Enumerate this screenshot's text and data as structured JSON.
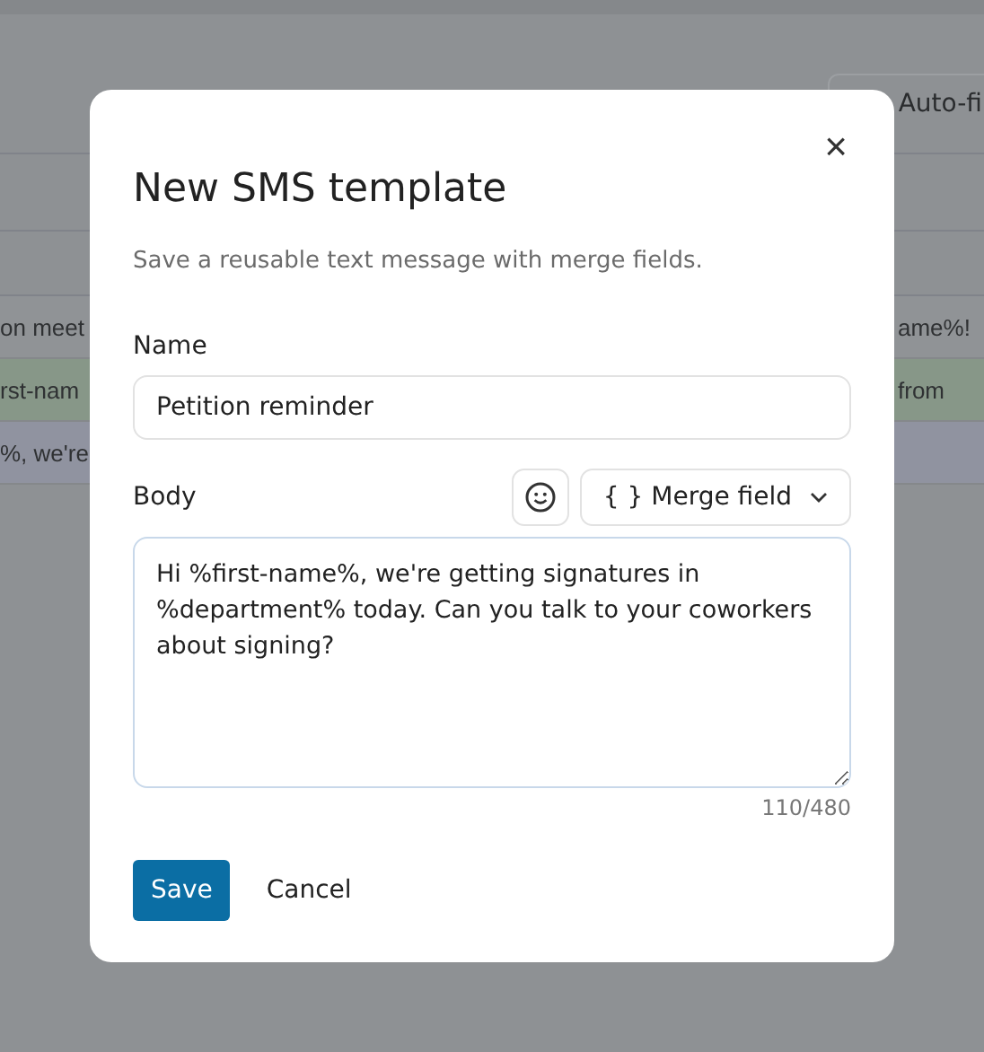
{
  "background": {
    "toolbar_button": "Auto-fi",
    "rows": [
      {
        "left": "on meet",
        "right": "ame%!",
        "selected": false
      },
      {
        "left": "rst-nam",
        "right": "from",
        "selected": true
      },
      {
        "left": "%, we're",
        "right": "",
        "selected": false
      }
    ]
  },
  "dialog": {
    "title": "New SMS template",
    "close": "×",
    "subtitle": "Save a reusable text message with merge fields.",
    "name_label": "Name",
    "name_value": "Petition reminder",
    "body_label": "Body",
    "merge_button": "{ } Merge field",
    "body_value": "Hi %first-name%, we're getting signatures in %department% today. Can you talk to your coworkers about signing?",
    "counter": "110/480",
    "buttons": [
      {
        "label": "Save",
        "kind": "primary"
      },
      {
        "label": "Cancel",
        "kind": "plain"
      }
    ]
  }
}
